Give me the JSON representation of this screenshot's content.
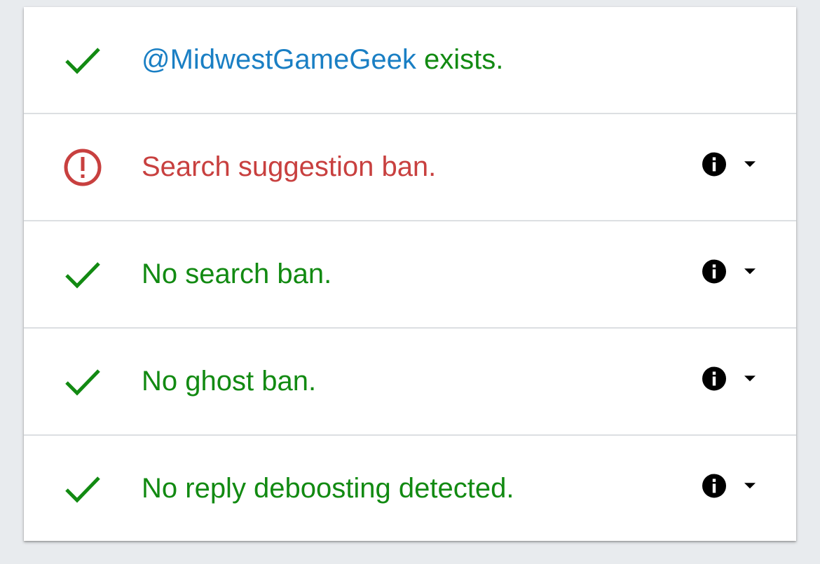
{
  "colors": {
    "success": "#128a12",
    "error": "#c8403f",
    "handle": "#1a7fc4",
    "icon": "#000000"
  },
  "results": {
    "account": {
      "handle": "@MidwestGameGeek",
      "status_text": " exists.",
      "icon": "check-icon"
    },
    "search_suggestion": {
      "text": "Search suggestion ban.",
      "icon": "error-circle-icon"
    },
    "search": {
      "text": "No search ban.",
      "icon": "check-icon"
    },
    "ghost": {
      "text": "No ghost ban.",
      "icon": "check-icon"
    },
    "reply_deboosting": {
      "text": "No reply deboosting detected.",
      "icon": "check-icon"
    }
  },
  "row_actions": {
    "info_icon": "info-icon",
    "expand_icon": "caret-down-icon"
  }
}
